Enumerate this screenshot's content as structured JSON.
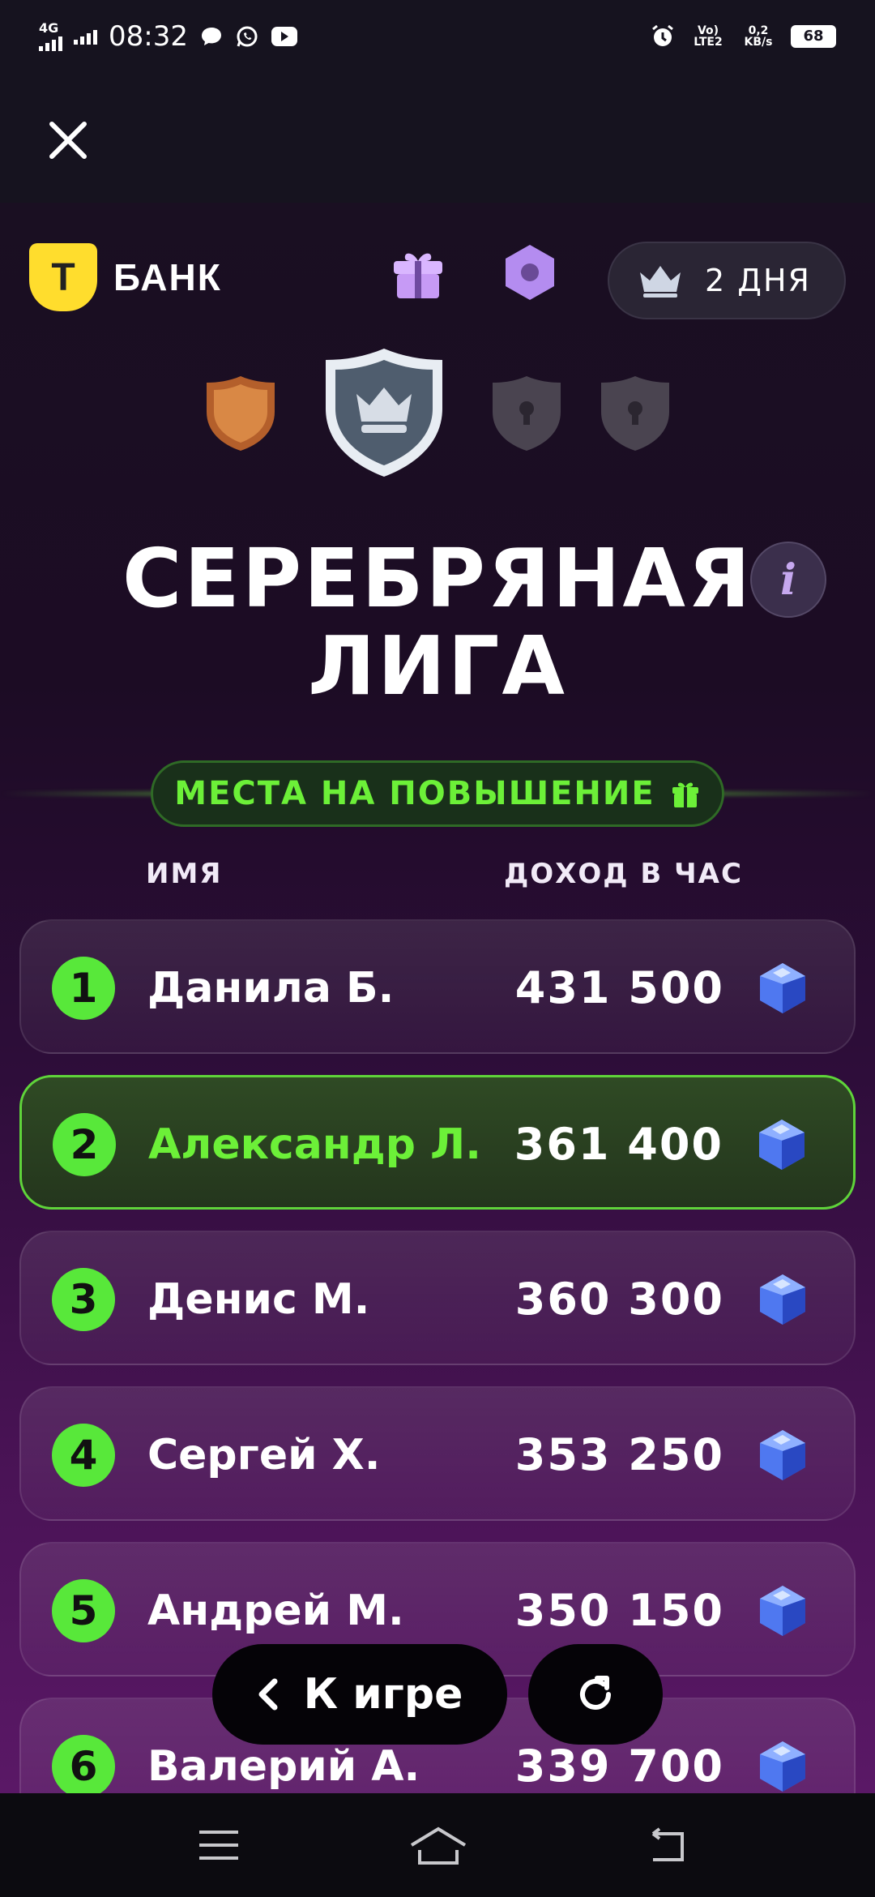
{
  "status_bar": {
    "network": "4G",
    "time": "08:32",
    "volte": "Vo) LTE2",
    "speed": "0,2 KB/s",
    "battery": "68"
  },
  "header": {
    "logo_letter": "Т",
    "logo_text": "БАНК",
    "days_label": "2 ДНЯ"
  },
  "league": {
    "title_line1": "СЕРЕБРЯНАЯ",
    "title_line2": "ЛИГА",
    "info_label": "i",
    "promotion_label": "МЕСТА НА ПОВЫШЕНИЕ"
  },
  "table": {
    "col_name": "ИМЯ",
    "col_income": "ДОХОД В ЧАС",
    "rows": [
      {
        "rank": "1",
        "name": "Данила Б.",
        "income": "431 500"
      },
      {
        "rank": "2",
        "name": "Александр Л.",
        "income": "361 400"
      },
      {
        "rank": "3",
        "name": "Денис М.",
        "income": "360 300"
      },
      {
        "rank": "4",
        "name": "Сергей Х.",
        "income": "353 250"
      },
      {
        "rank": "5",
        "name": "Андрей М.",
        "income": "350 150"
      },
      {
        "rank": "6",
        "name": "Валерий А.",
        "income": "339 700"
      }
    ],
    "highlighted_rank": "2"
  },
  "footer": {
    "back_label": "К игре"
  },
  "colors": {
    "accent_green": "#6cf038",
    "brand_yellow": "#ffdd2d",
    "purple": "#c6a8ef"
  }
}
